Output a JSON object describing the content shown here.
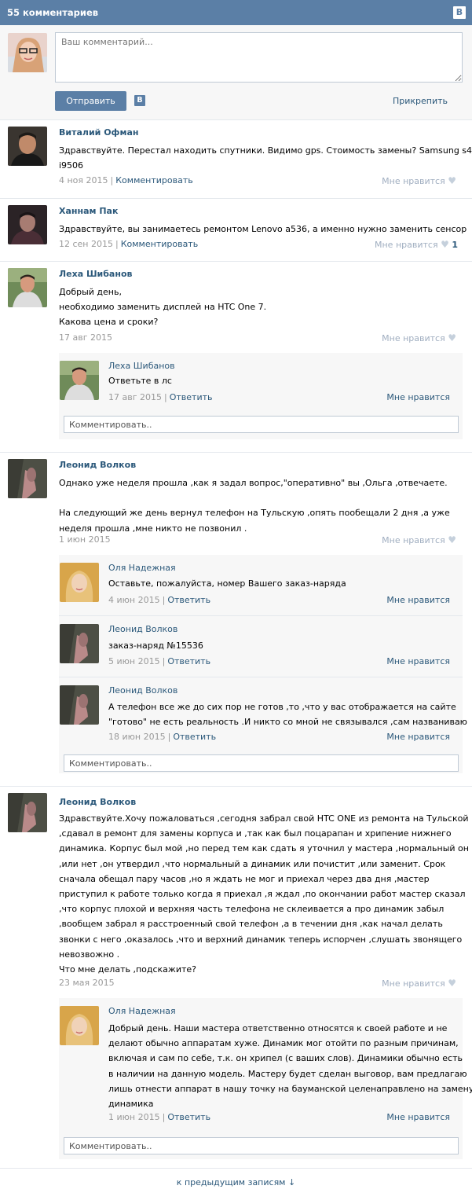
{
  "header": {
    "title": "55 комментариев",
    "logo": "В"
  },
  "compose": {
    "placeholder": "Ваш комментарий...",
    "send_label": "Отправить",
    "vk_badge": "В",
    "attach_label": "Прикрепить"
  },
  "labels": {
    "reply": "Ответить",
    "like": "Мне нравится",
    "comment": "Комментировать",
    "comment_placeholder": "Комментировать.."
  },
  "comments": [
    {
      "author": "Виталий Офман",
      "lines": [
        "Здравствуйте. Перестал находить спутники. Видимо gps. Стоимость замены? Samsung s4",
        "i9506"
      ],
      "date": "4 ноя 2015",
      "action": "Комментировать",
      "like": "Мне нравится"
    },
    {
      "author": "Ханнам Пак",
      "lines": [
        "Здравствуйте, вы занимаетесь ремонтом Lenovo a536, а именно нужно заменить сенсор"
      ],
      "date": "12 сен 2015",
      "action": "Комментировать",
      "like": "Мне нравится",
      "like_count": "1"
    },
    {
      "author": "Леха Шибанов",
      "lines": [
        "Добрый день,",
        "необходимо заменить дисплей на HTC One 7.",
        "Какова цена и сроки?"
      ],
      "date": "17 авг 2015",
      "like": "Мне нравится",
      "replies": [
        {
          "author": "Леха Шибанов",
          "lines": [
            "Ответьте в лс"
          ],
          "date": "17 авг 2015",
          "action": "Ответить",
          "like": "Мне нравится"
        }
      ],
      "comment_placeholder": "Комментировать.."
    },
    {
      "author": "Леонид Волков",
      "lines": [
        "Однако уже неделя прошла ,как я задал вопрос,\"оперативно\" вы ,Ольга ,отвечаете.",
        "",
        "На следующий же день вернул телефон на Тульскую ,опять пообещали 2 дня ,а уже",
        "неделя прошла ,мне никто не позвонил ."
      ],
      "date": "1 июн 2015",
      "like": "Мне нравится",
      "replies": [
        {
          "author": "Оля Надежная",
          "lines": [
            "Оставьте, пожалуйста, номер Вашего заказ-наряда"
          ],
          "date": "4 июн 2015",
          "action": "Ответить",
          "like": "Мне нравится"
        },
        {
          "author": "Леонид Волков",
          "lines": [
            "заказ-наряд №15536"
          ],
          "date": "5 июн 2015",
          "action": "Ответить",
          "like": "Мне нравится"
        },
        {
          "author": "Леонид Волков",
          "lines": [
            "А телефон все же до сих пор не готов ,то ,что у вас отображается на сайте",
            "\"готово\" не есть реальность .И никто со мной не связывался ,сам названиваю"
          ],
          "date": "18 июн 2015",
          "action": "Ответить",
          "like": "Мне нравится"
        }
      ],
      "comment_placeholder": "Комментировать.."
    },
    {
      "author": "Леонид Волков",
      "lines": [
        "Здравствуйте.Хочу пожаловаться ,сегодня забрал свой HTC ONE из ремонта на Тульской",
        ",сдавал в ремонт для замены корпуса и ,так как был поцарапан и хрипение нижнего",
        "динамика. Корпус был мой ,но перед тем как сдать я уточнил у мастера ,нормальный он",
        ",или нет ,он утвердил ,что нормальный а динамик или почистит ,или заменит. Срок",
        "сначала обещал пару часов ,но я ждать не мог и приехал через два дня ,мастер",
        "приступил к работе только когда я приехал ,я ждал ,по окончании работ мастер сказал",
        ",что корпус плохой и верхняя часть телефона не склеивается а про динамик забыл",
        ",вообщем забрал я расстроенный свой телефон ,а в течении дня ,как начал делать",
        "звонки с него ,оказалось ,что и верхний динамик теперь испорчен ,слушать звонящего",
        "невозвожно .",
        "Что мне делать ,подскажите?"
      ],
      "date": "23 мая 2015",
      "like": "Мне нравится",
      "replies": [
        {
          "author": "Оля Надежная",
          "lines": [
            "Добрый день. Наши мастера ответственно относятся к своей работе и не",
            "делают обычно аппаратам хуже. Динамик мог отойти по разным причинам,",
            "включая и сам по себе, т.к. он хрипел (с ваших слов). Динамики обычно есть",
            "в наличии на данную модель. Мастеру будет сделан выговор, вам предлагаю",
            "лишь отнести аппарат в нашу точку на бауманской целенаправлено на замену",
            "динамика"
          ],
          "date": "1 июн 2015",
          "action": "Ответить",
          "like": "Мне нравится"
        }
      ],
      "comment_placeholder": "Комментировать.."
    }
  ],
  "more": {
    "label": "к предыдущим записям",
    "arrow": "↓"
  }
}
